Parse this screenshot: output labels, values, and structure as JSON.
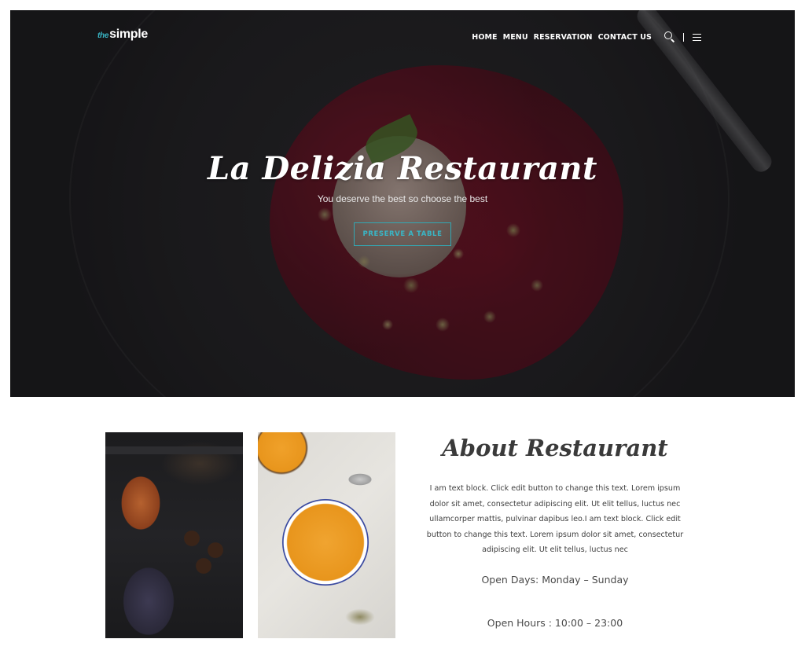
{
  "header": {
    "logo_prefix": "the",
    "logo_main": "simple",
    "nav": [
      "HOME",
      "MENU",
      "RESERVATION",
      "CONTACT US"
    ],
    "icons": [
      "search-icon",
      "menu-icon"
    ]
  },
  "hero": {
    "title": "La Delizia Restaurant",
    "subtitle": "You deserve the best so choose the best",
    "button_label": "PRESERVE A TABLE"
  },
  "about": {
    "title": "About Restaurant",
    "body": "I am text block. Click edit button to change this text. Lorem ipsum dolor sit amet, consectetur adipiscing elit. Ut elit tellus, luctus nec ullamcorper mattis, pulvinar dapibus leo.I am text block. Click edit button to change this text. Lorem ipsum dolor sit amet, consectetur adipiscing elit. Ut elit tellus, luctus nec",
    "open_days": "Open Days: Monday – Sunday",
    "open_hours": "Open Hours : 10:00 – 23:00"
  },
  "colors": {
    "accent": "#39b6c6",
    "text": "#3b3b3b"
  }
}
